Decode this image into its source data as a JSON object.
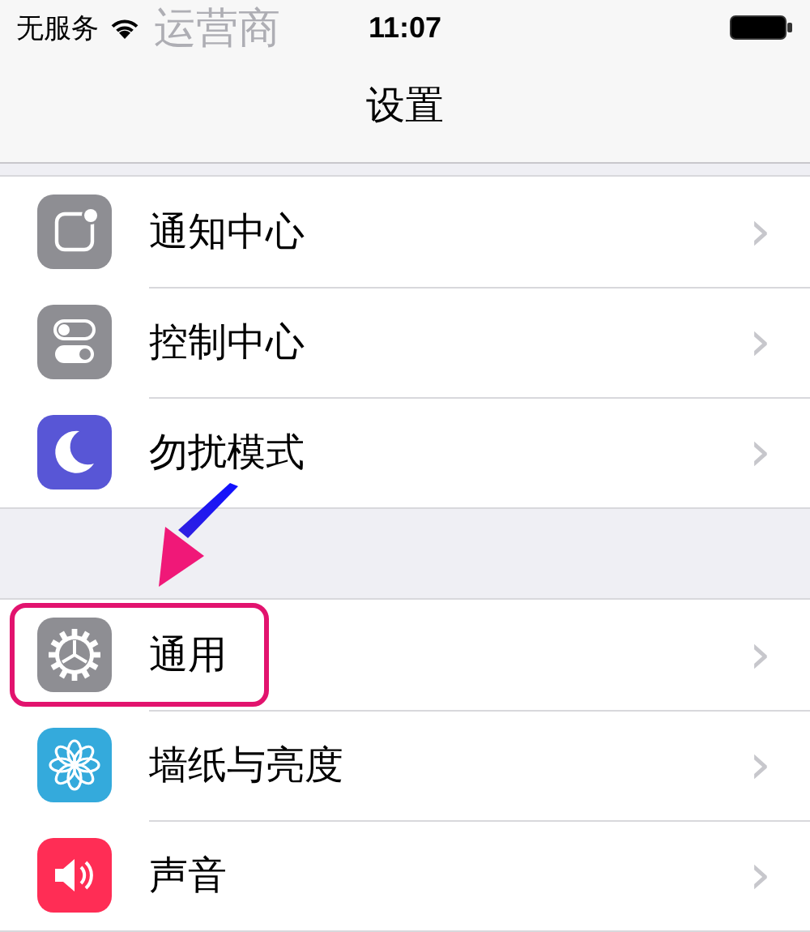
{
  "status_bar": {
    "carrier": "无服务",
    "time": "11:07",
    "behind_text": "运营商"
  },
  "title": "设置",
  "groups": [
    [
      {
        "label": "通知中心",
        "kind": "notification",
        "highlighted": false,
        "chevron": "›"
      },
      {
        "label": "控制中心",
        "kind": "control",
        "highlighted": false,
        "chevron": "›"
      },
      {
        "label": "勿扰模式",
        "kind": "moon",
        "highlighted": false,
        "chevron": "›"
      }
    ],
    [
      {
        "label": "通用",
        "kind": "gear",
        "highlighted": true,
        "chevron": "›"
      },
      {
        "label": "墙纸与亮度",
        "kind": "flower",
        "highlighted": false,
        "chevron": "›"
      },
      {
        "label": "声音",
        "kind": "sound",
        "highlighted": false,
        "chevron": "›"
      }
    ]
  ]
}
